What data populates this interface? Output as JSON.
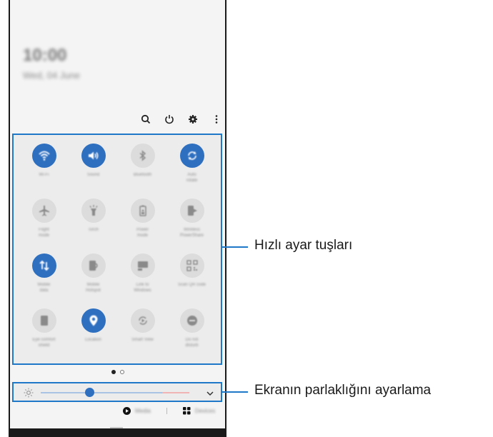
{
  "lock_info": {
    "time": "10:00",
    "date": "Wed, 04 June"
  },
  "quick_panel": {
    "tiles": [
      {
        "label": "Wi-Fi",
        "icon": "wifi-icon",
        "active": true
      },
      {
        "label": "Sound",
        "icon": "sound-icon",
        "active": true
      },
      {
        "label": "Bluetooth",
        "icon": "bluetooth-icon",
        "active": false
      },
      {
        "label": "Auto\nrotate",
        "icon": "auto-rotate-icon",
        "active": true
      },
      {
        "label": "Flight\nmode",
        "icon": "airplane-icon",
        "active": false
      },
      {
        "label": "Torch",
        "icon": "torch-icon",
        "active": false
      },
      {
        "label": "Power\nmode",
        "icon": "battery-icon",
        "active": false
      },
      {
        "label": "Wireless\nPowerShare",
        "icon": "powershare-icon",
        "active": false
      },
      {
        "label": "Mobile\ndata",
        "icon": "mobile-data-icon",
        "active": true
      },
      {
        "label": "Mobile\nHotspot",
        "icon": "hotspot-icon",
        "active": false
      },
      {
        "label": "Link to\nWindows",
        "icon": "link-windows-icon",
        "active": false
      },
      {
        "label": "Scan QR code",
        "icon": "qr-code-icon",
        "active": false
      },
      {
        "label": "Eye comfort\nshield",
        "icon": "eye-comfort-icon",
        "active": false
      },
      {
        "label": "Location",
        "icon": "location-icon",
        "active": true
      },
      {
        "label": "Smart View",
        "icon": "smart-view-icon",
        "active": false
      },
      {
        "label": "Do not\ndisturb",
        "icon": "do-not-disturb-icon",
        "active": false
      }
    ]
  },
  "brightness": {
    "level": 0.33
  },
  "media_row": {
    "media_label": "Media",
    "devices_label": "Devices"
  },
  "callouts": {
    "quick_settings": "Hızlı ayar tuşları",
    "brightness": "Ekranın parlaklığını ayarlama"
  },
  "colors": {
    "accent": "#2e6fc0",
    "callout": "#1f78c8"
  }
}
